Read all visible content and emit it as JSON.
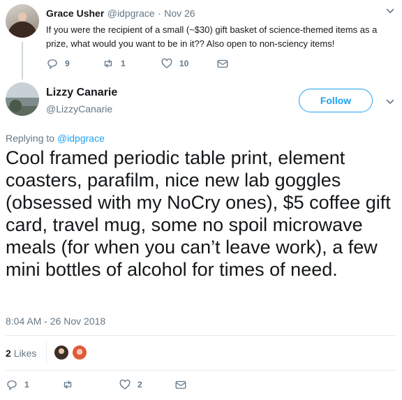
{
  "parent_tweet": {
    "name": "Grace Usher",
    "handle": "@idpgrace",
    "separator": "·",
    "date": "Nov 26",
    "text": "If you were the recipient of a small (~$30) gift basket of science-themed items as a prize, what would you want to be in it?? Also open to non-sciency items!",
    "replies": "9",
    "retweets": "1",
    "likes": "10"
  },
  "main_tweet": {
    "name": "Lizzy Canarie",
    "handle": "@LizzyCanarie",
    "follow_label": "Follow",
    "replying_prefix": "Replying to",
    "replying_to": "@idpgrace",
    "text": "Cool framed periodic table print, element coasters, parafilm, nice new lab goggles (obsessed with my NoCry ones), $5 coffee gift card, travel mug, some no spoil microwave meals (for when you can’t leave work), a few mini bottles of alcohol for times of need.",
    "timestamp": "8:04 AM - 26 Nov 2018",
    "likes_count": "2",
    "likes_label": "Likes",
    "replies": "1",
    "retweets": "",
    "likes": "2"
  },
  "colors": {
    "accent": "#1da1f2",
    "muted": "#657786",
    "text": "#14171a",
    "thread_line": "#ccd6dd"
  },
  "icons": [
    "reply-icon",
    "retweet-icon",
    "like-icon",
    "message-icon",
    "chevron-down-icon"
  ]
}
